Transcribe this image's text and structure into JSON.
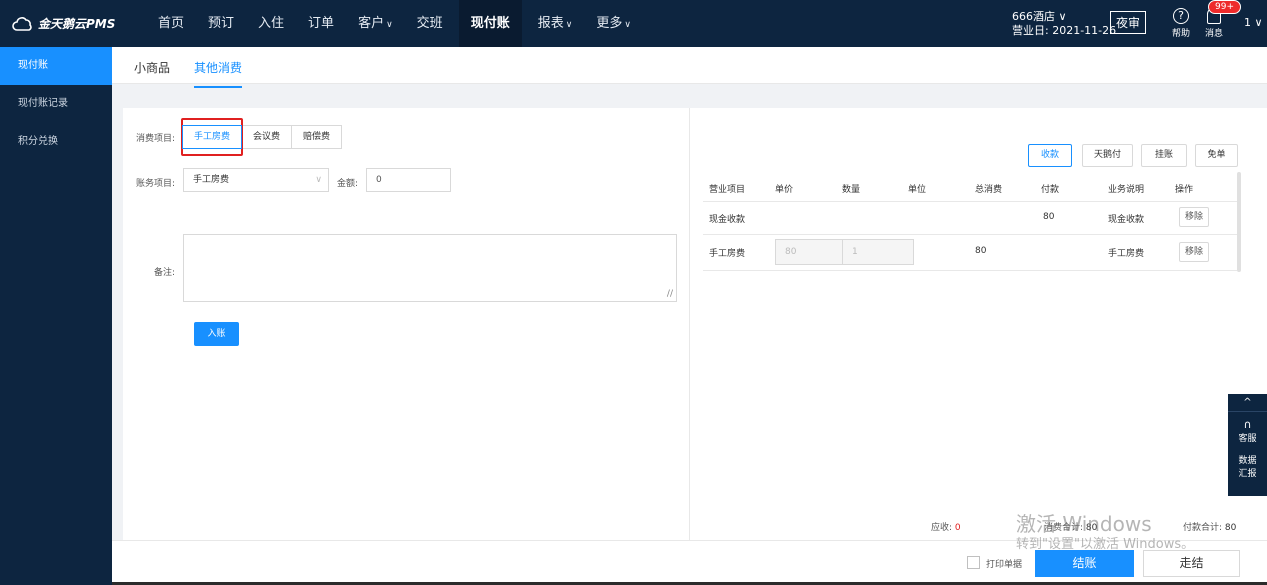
{
  "brand": {
    "logo_text": "金天鹅云PMS"
  },
  "nav": [
    {
      "label": "首页"
    },
    {
      "label": "预订"
    },
    {
      "label": "入住"
    },
    {
      "label": "订单"
    },
    {
      "label": "客户",
      "caret": "∨"
    },
    {
      "label": "交班"
    },
    {
      "label": "现付账",
      "active": true
    },
    {
      "label": "报表",
      "caret": "∨"
    },
    {
      "label": "更多",
      "caret": "∨"
    }
  ],
  "header": {
    "hotel_name": "666酒店 ∨",
    "business_date": "营业日: 2021-11-26",
    "night_audit": "夜审",
    "help_label": "帮助",
    "message_label": "消息",
    "message_badge": "99+",
    "user_menu": "1 ∨"
  },
  "sidebar": {
    "items": [
      {
        "label": "现付账",
        "active": true
      },
      {
        "label": "现付账记录"
      },
      {
        "label": "积分兑换"
      }
    ]
  },
  "subtabs": {
    "small_goods": "小商品",
    "other_consumption": "其他消费"
  },
  "form": {
    "consume_item_label": "消费项目:",
    "consume_items": [
      "手工房费",
      "会议费",
      "赔偿费"
    ],
    "account_item_label": "账务项目:",
    "account_item_value": "手工房费",
    "amount_label": "金额:",
    "amount_value": "0",
    "remark_label": "备注:",
    "submit_label": "入账"
  },
  "actions": {
    "collect": "收款",
    "tianezhifu": "天鹅付",
    "hang": "挂账",
    "waive": "免单"
  },
  "table": {
    "headers": [
      "营业项目",
      "单价",
      "数量",
      "单位",
      "总消费",
      "付款",
      "业务说明",
      "操作"
    ],
    "rows": [
      {
        "item": "现金收款",
        "payment": "80",
        "desc": "现金收款",
        "op": "移除"
      },
      {
        "item": "手工房费",
        "unit_price": "80",
        "qty": "1",
        "total": "80",
        "desc": "手工房费",
        "op": "移除"
      }
    ]
  },
  "float_panel": {
    "up": "^",
    "service": "客服",
    "report_line1": "数据",
    "report_line2": "汇报"
  },
  "summary": {
    "receivable_label": "应收:",
    "receivable_value": "0",
    "consume_label": "消费合计:",
    "consume_value": "80",
    "pay_label": "付款合计:",
    "pay_value": "80"
  },
  "footer": {
    "print_label": "打印单据",
    "checkout": "结账",
    "leave": "走结"
  },
  "watermark": {
    "line1": "激活 Windows",
    "line2": "转到\"设置\"以激活 Windows。"
  }
}
